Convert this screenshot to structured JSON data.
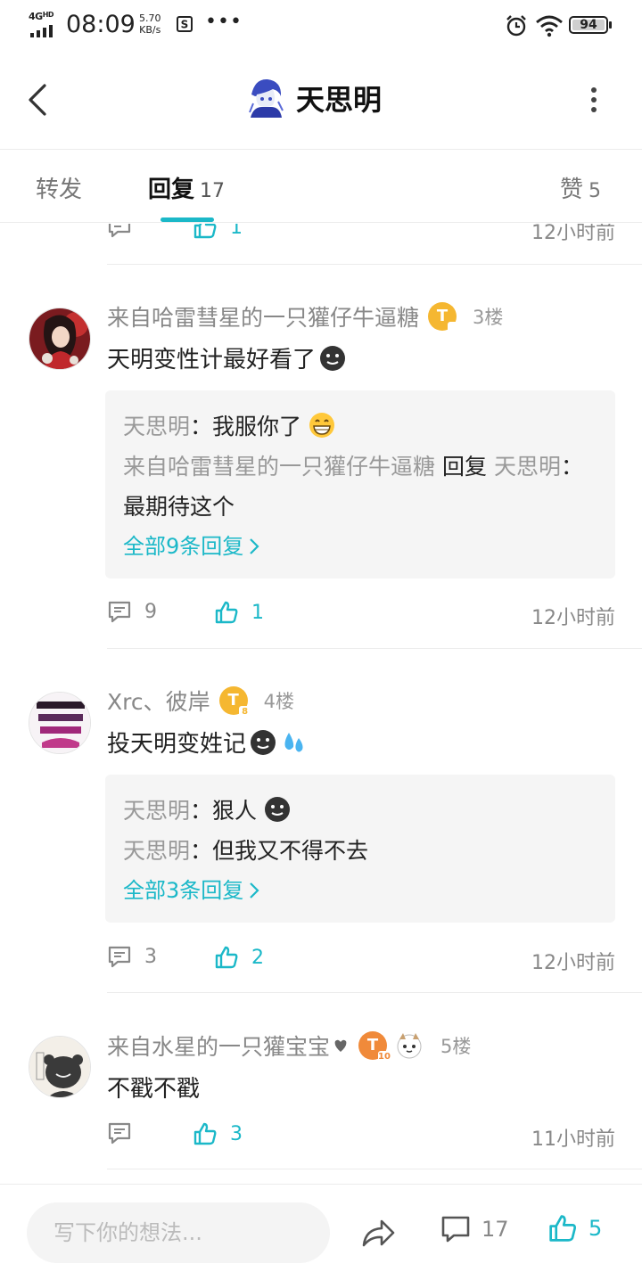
{
  "status_bar": {
    "network": "4G",
    "network_sup": "HD",
    "time": "08:09",
    "speed_value": "5.70",
    "speed_unit": "KB/s",
    "more_dots": "•••",
    "battery": "94"
  },
  "header": {
    "title": "天思明"
  },
  "tabs": {
    "forward_label": "转发",
    "reply_label": "回复",
    "reply_count": "17",
    "like_label": "赞",
    "like_count": "5"
  },
  "top_partial": {
    "like_count": "1",
    "time": "12小时前"
  },
  "comments": [
    {
      "name": "来自哈雷彗星的一只獾仔牛逼糖",
      "badge": "T",
      "badge_level": "",
      "floor": "3楼",
      "text": "天明变性计最好看了",
      "replies": [
        {
          "name": "天思明",
          "sep": "：",
          "text": "我服你了"
        },
        {
          "name": "来自哈雷彗星的一只獾仔牛逼糖",
          "keyword": "回复",
          "target": "天思明",
          "sep": "：",
          "text": "最期待这个"
        }
      ],
      "more_replies": "全部9条回复",
      "comment_count": "9",
      "like_count": "1",
      "time": "12小时前"
    },
    {
      "name": "Xrc、彼岸",
      "badge": "T",
      "badge_level": "8",
      "floor": "4楼",
      "text": "投天明变姓记",
      "replies": [
        {
          "name": "天思明",
          "sep": "：",
          "text": "狠人"
        },
        {
          "name": "天思明",
          "sep": "：",
          "text": "但我又不得不去"
        }
      ],
      "more_replies": "全部3条回复",
      "comment_count": "3",
      "like_count": "2",
      "time": "12小时前"
    },
    {
      "name": "来自水星的一只獾宝宝",
      "badge": "T",
      "badge_level": "10",
      "floor": "5楼",
      "text": "不戳不戳",
      "replies": [],
      "more_replies": "",
      "comment_count": "",
      "like_count": "3",
      "time": "11小时前"
    }
  ],
  "bottom_bar": {
    "input_placeholder": "写下你的想法...",
    "comment_count": "17",
    "like_count": "5"
  },
  "colors": {
    "accent": "#1bb8c8",
    "badge_gold": "#f5b731",
    "badge_orange": "#f08a3a",
    "muted": "#888888"
  }
}
